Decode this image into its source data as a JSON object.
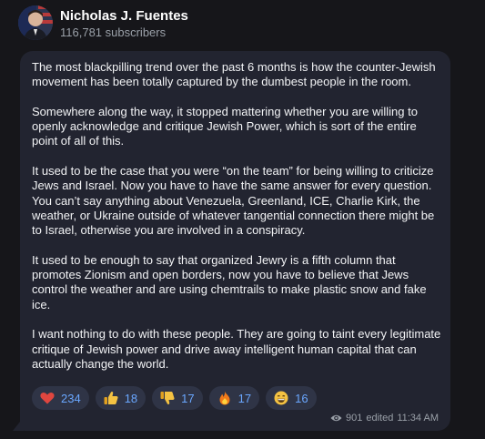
{
  "channel": {
    "name": "Nicholas J. Fuentes",
    "subscribers": "116,781 subscribers"
  },
  "post": {
    "paragraphs": [
      "The most blackpilling trend over the past 6 months is how the counter-Jewish movement has been totally captured by the dumbest people in the room.",
      "Somewhere along the way, it stopped mattering whether you are willing to openly acknowledge and critique Jewish Power, which is sort of the entire point of all of this.",
      "It used to be the case that you were “on the team” for being willing to criticize Jews and Israel. Now you have to have the same answer for every question. You can’t say anything about Venezuela, Greenland, ICE, Charlie Kirk, the weather, or Ukraine outside of whatever tangential connection there might be to Israel, otherwise you are involved in a conspiracy.",
      "It used to be enough to say that organized Jewry is a fifth column that promotes Zionism and open borders, now you have to believe that Jews control the weather and are using chemtrails to make plastic snow and fake ice.",
      "I want nothing to do with these people. They are going to taint every legitimate critique of Jewish power and drive away intelligent human capital that can actually change the world."
    ],
    "reactions": [
      {
        "icon": "heart-icon",
        "count": "234"
      },
      {
        "icon": "thumbs-up-icon",
        "count": "18"
      },
      {
        "icon": "thumbs-down-icon",
        "count": "17"
      },
      {
        "icon": "fire-icon",
        "count": "17"
      },
      {
        "icon": "grinning-face-icon",
        "count": "16"
      }
    ],
    "views": "901",
    "edited": "edited",
    "time": "11:34 AM"
  },
  "colors": {
    "background": "#16161a",
    "bubble": "#222430",
    "reaction_bg": "#2f3446",
    "accent": "#6aa7ff",
    "muted": "#9aa0a8"
  }
}
